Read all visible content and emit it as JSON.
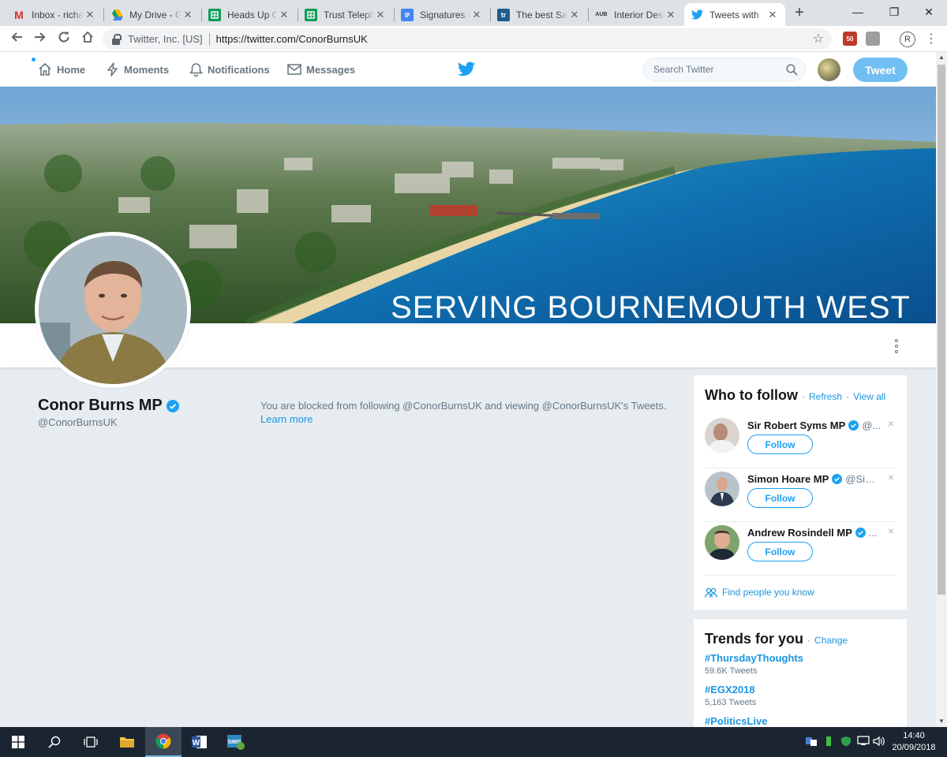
{
  "browser": {
    "tabs": [
      {
        "label": "Inbox - richa",
        "icon": "gmail-icon",
        "color": "#d93025",
        "glyph": "M"
      },
      {
        "label": "My Drive - G",
        "icon": "drive-icon",
        "color": "#1fa463",
        "glyph": "▲"
      },
      {
        "label": "Heads Up Co",
        "icon": "sheets-icon",
        "color": "#0f9d58",
        "glyph": "▦"
      },
      {
        "label": "Trust Teleph",
        "icon": "sheets-icon",
        "color": "#0f9d58",
        "glyph": "▦"
      },
      {
        "label": "Signatures.d",
        "icon": "docs-icon",
        "color": "#4285f4",
        "glyph": "≡"
      },
      {
        "label": "The best San",
        "icon": "tr-icon",
        "color": "#1f5c8b",
        "glyph": "tr"
      },
      {
        "label": "Interior Desi",
        "icon": "aub-icon",
        "color": "#444444",
        "glyph": "AUB"
      },
      {
        "label": "Tweets with",
        "icon": "twitter-icon",
        "color": "#1da1f2",
        "glyph": ""
      }
    ],
    "site_identity": "Twitter, Inc. [US]",
    "url": "https://twitter.com/ConorBurnsUK",
    "profile_initial": "R",
    "ext_badge": "50"
  },
  "nav": {
    "home": "Home",
    "moments": "Moments",
    "notifications": "Notifications",
    "messages": "Messages",
    "search_placeholder": "Search Twitter",
    "tweet_button": "Tweet"
  },
  "banner": {
    "text": "SERVING BOURNEMOUTH WEST"
  },
  "profile": {
    "name": "Conor Burns MP",
    "handle": "@ConorBurnsUK",
    "blocked_message": "You are blocked from following @ConorBurnsUK and viewing @ConorBurnsUK's Tweets.",
    "learn_more": "Learn more"
  },
  "who_to_follow": {
    "title": "Who to follow",
    "dot": "·",
    "refresh": "Refresh",
    "view_all": "View all",
    "close": "×",
    "follow_label": "Follow",
    "items": [
      {
        "name": "Sir Robert Syms MP",
        "handle": "@..."
      },
      {
        "name": "Simon Hoare MP",
        "handle": "@Sim..."
      },
      {
        "name": "Andrew Rosindell MP",
        "handle": "..."
      }
    ],
    "find_people": "Find people you know"
  },
  "trends": {
    "title": "Trends for you",
    "dot": "·",
    "change": "Change",
    "items": [
      {
        "tag": "#ThursdayThoughts",
        "count": "59.6K Tweets"
      },
      {
        "tag": "#EGX2018",
        "count": "5,163 Tweets"
      },
      {
        "tag": "#PoliticsLive",
        "count": ""
      }
    ]
  },
  "taskbar": {
    "time": "14:40",
    "date": "20/09/2018"
  },
  "colors": {
    "twitter_blue": "#1da1f2",
    "link_blue": "#1b95e0",
    "page_bg": "#e6ecf0",
    "verified": "#1da1f2"
  }
}
